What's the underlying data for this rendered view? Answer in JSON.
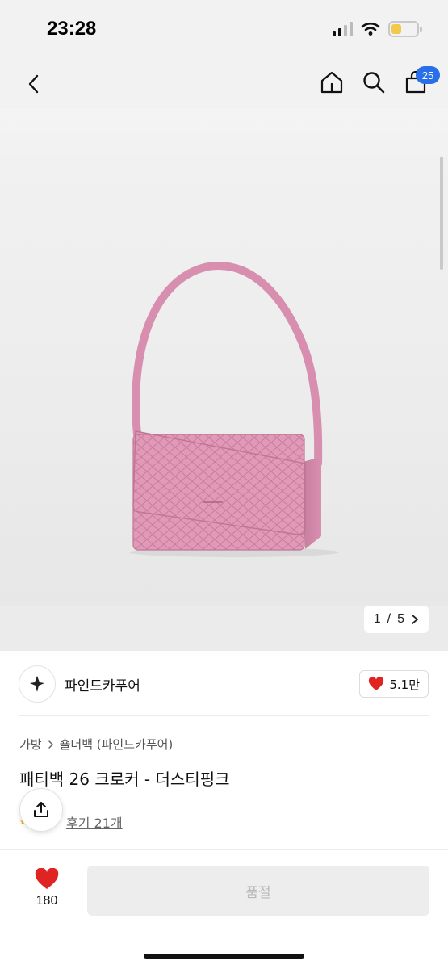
{
  "status": {
    "time": "23:28"
  },
  "nav": {
    "cart_count": "25"
  },
  "gallery": {
    "current": "1",
    "separator": "/",
    "total": "5"
  },
  "brand": {
    "name": "파인드카푸어",
    "like_count": "5.1만"
  },
  "breadcrumb": {
    "category": "가방",
    "subcategory": "숄더백 (파인드카푸어)"
  },
  "product": {
    "title": "패티백 26 크로커 - 더스티핑크",
    "review_label": "후기 21개"
  },
  "bottom": {
    "wish_count": "180",
    "buy_label": "품절"
  },
  "colors": {
    "accent_blue": "#2a6fe8",
    "heart_red": "#e02424",
    "bag_pink": "#e09ab8"
  }
}
